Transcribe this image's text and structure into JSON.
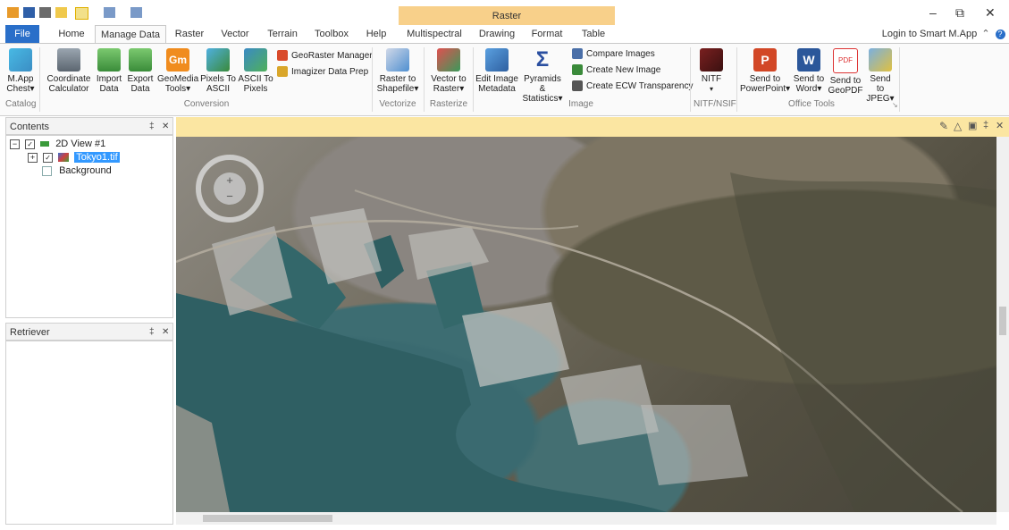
{
  "title_bar": {
    "context_group": "Raster",
    "login_label": "Login to Smart M.App",
    "icons": [
      "app-icon",
      "save-icon",
      "undo-icon",
      "zoom-icon",
      "pan-icon",
      "pen-icon",
      "customize-icon"
    ]
  },
  "tabs": [
    {
      "label": "File"
    },
    {
      "label": "Home"
    },
    {
      "label": "Manage Data"
    },
    {
      "label": "Raster"
    },
    {
      "label": "Vector"
    },
    {
      "label": "Terrain"
    },
    {
      "label": "Toolbox"
    },
    {
      "label": "Help"
    },
    {
      "label": "Multispectral"
    },
    {
      "label": "Drawing"
    },
    {
      "label": "Format"
    },
    {
      "label": "Table"
    }
  ],
  "ribbon": {
    "catalog": {
      "label": "Catalog",
      "mapp_chest": "M.App Chest▾"
    },
    "conversion": {
      "label": "Conversion",
      "coordinate_calculator": "Coordinate Calculator",
      "import_data": "Import Data",
      "export_data": "Export Data",
      "geomedia_tools": "GeoMedia Tools▾",
      "pixels_to_ascii": "Pixels To ASCII",
      "ascii_to_pixels": "ASCII To Pixels",
      "georaster_manager": "GeoRaster Manager",
      "imagizer_data_prep": "Imagizer Data Prep"
    },
    "vectorize": {
      "label": "Vectorize",
      "raster_to_shapefile": "Raster to Shapefile▾"
    },
    "rasterize": {
      "label": "Rasterize",
      "vector_to_raster": "Vector to Raster▾"
    },
    "image": {
      "label": "Image",
      "edit_image_metadata": "Edit Image Metadata",
      "pyramids_statistics": "Pyramids & Statistics▾",
      "compare_images": "Compare Images",
      "create_new_image": "Create New Image",
      "create_ecw_transparency": "Create ECW Transparency"
    },
    "nitf": {
      "label": "NITF/NSIF",
      "nitf": "NITF"
    },
    "office_tools": {
      "label": "Office Tools",
      "send_to_powerpoint": "Send to PowerPoint▾",
      "send_to_word": "Send to Word▾",
      "send_to_geopdf": "Send to GeoPDF",
      "send_to_jpeg": "Send to JPEG▾"
    }
  },
  "contents_panel": {
    "title": "Contents",
    "tree": {
      "view": "2D View #1",
      "layer": "Tokyo1.tif",
      "background": "Background"
    }
  },
  "retriever_panel": {
    "title": "Retriever"
  },
  "map_view": {
    "map_toolbar_icons": [
      "pencil-icon",
      "warning-icon",
      "lock-icon",
      "pin-icon",
      "close-icon"
    ]
  }
}
